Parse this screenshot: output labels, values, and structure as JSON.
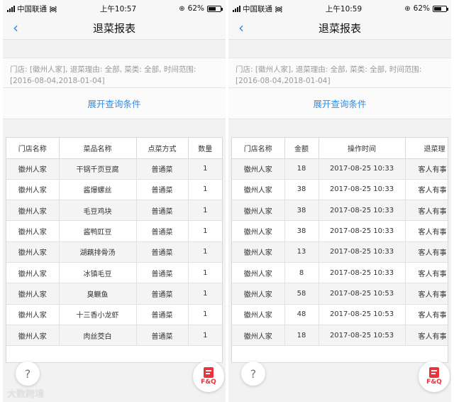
{
  "status_left": {
    "carrier": "中国联通",
    "time": "上午10:57",
    "battery": "62%",
    "battery_level": 0.62
  },
  "status_right": {
    "carrier": "中国联通",
    "time": "上午10:59",
    "battery": "62%",
    "battery_level": 0.62
  },
  "nav": {
    "back_icon": "‹",
    "title": "退菜报表"
  },
  "filter_text": "门店: [徽州人家], 退菜理由: 全部, 菜类: 全部, 时间范围: [2016-08-04,2018-01-04]",
  "expand_label": "展开查询条件",
  "left_table": {
    "headers": [
      "门店名称",
      "菜品名称",
      "点菜方式",
      "数量"
    ],
    "rows": [
      [
        "徽州人家",
        "干锅千页豆腐",
        "普通菜",
        "1"
      ],
      [
        "徽州人家",
        "酱爆螺丝",
        "普通菜",
        "1"
      ],
      [
        "徽州人家",
        "毛豆鸡块",
        "普通菜",
        "1"
      ],
      [
        "徽州人家",
        "酱鸭豇豆",
        "普通菜",
        "1"
      ],
      [
        "徽州人家",
        "湖藕排骨汤",
        "普通菜",
        "1"
      ],
      [
        "徽州人家",
        "冰镇毛豆",
        "普通菜",
        "1"
      ],
      [
        "徽州人家",
        "臭鳜鱼",
        "普通菜",
        "1"
      ],
      [
        "徽州人家",
        "十三香小龙虾",
        "普通菜",
        "1"
      ],
      [
        "徽州人家",
        "肉丝茭白",
        "普通菜",
        "1"
      ]
    ]
  },
  "right_table": {
    "headers": [
      "门店名称",
      "金额",
      "操作时间",
      "退菜理"
    ],
    "rows": [
      [
        "徽州人家",
        "18",
        "2017-08-25 10:33",
        "客人有事"
      ],
      [
        "徽州人家",
        "38",
        "2017-08-25 10:33",
        "客人有事"
      ],
      [
        "徽州人家",
        "38",
        "2017-08-25 10:33",
        "客人有事"
      ],
      [
        "徽州人家",
        "38",
        "2017-08-25 10:33",
        "客人有事"
      ],
      [
        "徽州人家",
        "13",
        "2017-08-25 10:33",
        "客人有事"
      ],
      [
        "徽州人家",
        "8",
        "2017-08-25 10:33",
        "客人有事"
      ],
      [
        "徽州人家",
        "58",
        "2017-08-25 10:53",
        "客人有事"
      ],
      [
        "徽州人家",
        "48",
        "2017-08-25 10:53",
        "客人有事"
      ],
      [
        "徽州人家",
        "18",
        "2017-08-25 10:53",
        "客人有事"
      ]
    ]
  },
  "help_label": "?",
  "faq_label": "F&Q",
  "watermark": "大数跨境",
  "colors": {
    "accent": "#2e8de8",
    "faq_red": "#e8343a"
  }
}
